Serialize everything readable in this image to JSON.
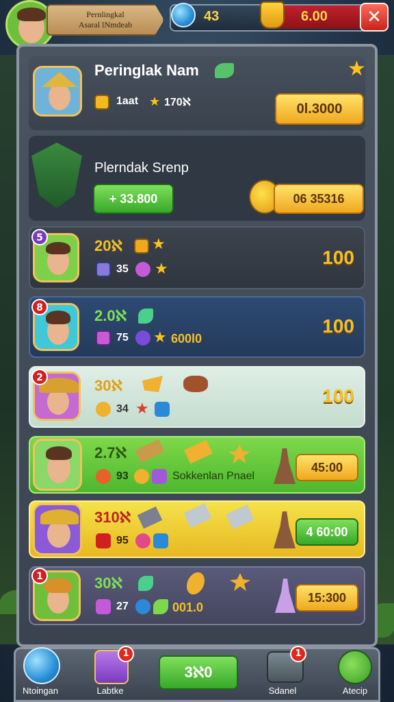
{
  "header": {
    "player_line1": "Pernlingkal",
    "player_line2": "Asaral lNmdeab",
    "gems": "43",
    "gold": "6.00",
    "close_label": "✕"
  },
  "top_card": {
    "name": "Peringlak Nam",
    "stat_a": "1aat",
    "stat_b": "170ℵ",
    "button": "0l.3000"
  },
  "group_card": {
    "title": "Plerndak Srenp",
    "green_button": "+ 33.800",
    "gold_button": "06 35316"
  },
  "rows": [
    {
      "badge": "5",
      "level": "20ℵ",
      "count": "35",
      "score": "100",
      "extra": "",
      "button": ""
    },
    {
      "badge": "8",
      "level": "2.0ℵ",
      "count": "75",
      "score": "100",
      "extra": "600l0",
      "button": ""
    },
    {
      "badge": "2",
      "level": "30ℵ",
      "count": "34",
      "score": "100",
      "extra": "",
      "button": ""
    },
    {
      "badge": "",
      "level": "2.7ℵ",
      "count": "93",
      "score": "",
      "extra": "Sokkenlan Pnael",
      "button": "45:00"
    },
    {
      "badge": "",
      "level": "310ℵ",
      "count": "95",
      "score": "",
      "extra": "",
      "button": "4 60:00"
    },
    {
      "badge": "1",
      "level": "30ℵ",
      "count": "27",
      "score": "",
      "extra": "001.0",
      "button": "15:300"
    }
  ],
  "nav": {
    "items": [
      {
        "label": "Ntoingan",
        "badge": ""
      },
      {
        "label": "Labtke",
        "badge": "1"
      },
      {
        "label": "3ℵ0",
        "badge": ""
      },
      {
        "label": "Sdanel",
        "badge": "1"
      },
      {
        "label": "Atecip",
        "badge": ""
      }
    ]
  },
  "colors": {
    "gold": "#f5c026",
    "green": "#5cc93e",
    "red": "#c8241c",
    "panel": "#3f4854"
  }
}
